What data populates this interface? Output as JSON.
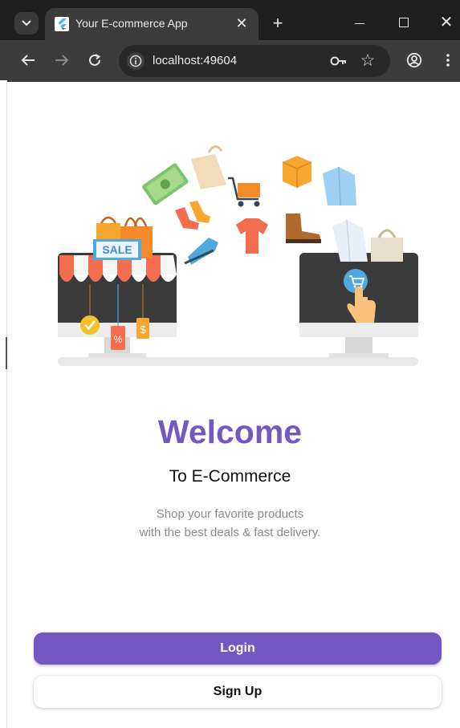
{
  "browser": {
    "tab_title": "Your E-commerce App",
    "url": "localhost:49604",
    "new_tab_symbol": "+",
    "tab_close_symbol": "✕",
    "window_close_symbol": "✕"
  },
  "colors": {
    "accent": "#7458c2",
    "tab_strip": "#1f1f1f",
    "toolbar": "#3c3c3c"
  },
  "illustration": {
    "sale_sign": "SALE",
    "percent_tag": "%",
    "dollar_tag": "$"
  },
  "hero": {
    "title": "Welcome",
    "subtitle": "To E-Commerce",
    "description_line1": "Shop your favorite products",
    "description_line2": "with the best deals & fast delivery."
  },
  "actions": {
    "login_label": "Login",
    "signup_label": "Sign Up"
  }
}
